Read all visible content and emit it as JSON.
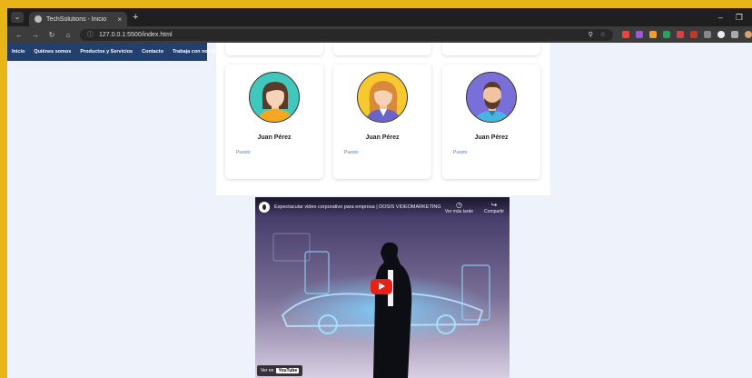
{
  "browser": {
    "tab_title": "TechSolutions - Inicio",
    "tab_close": "×",
    "new_tab": "+",
    "url": "127.0.0.1:5500/index.html",
    "min": "–",
    "restore": "❐"
  },
  "nav": {
    "items": [
      "Inicio",
      "Quiénes somos",
      "Productos y Servicios",
      "Contacto",
      "Trabaja con nosotros"
    ]
  },
  "team": {
    "members": [
      {
        "name": "Juan Pérez",
        "role": "Puesto"
      },
      {
        "name": "Juan Pérez",
        "role": "Puesto"
      },
      {
        "name": "Juan Pérez",
        "role": "Puesto"
      }
    ]
  },
  "video": {
    "title": "Espectacular video corporativo para empresa | DOSIS VIDEOMARKETING",
    "watch_later": "Ver más tarde",
    "share": "Compartir",
    "watch_on": "Ver en",
    "youtube": "YouTube"
  },
  "colors": {
    "nav_bg": "#233f6e",
    "frame": "#e8b518",
    "page_bg": "#eef3fb"
  }
}
